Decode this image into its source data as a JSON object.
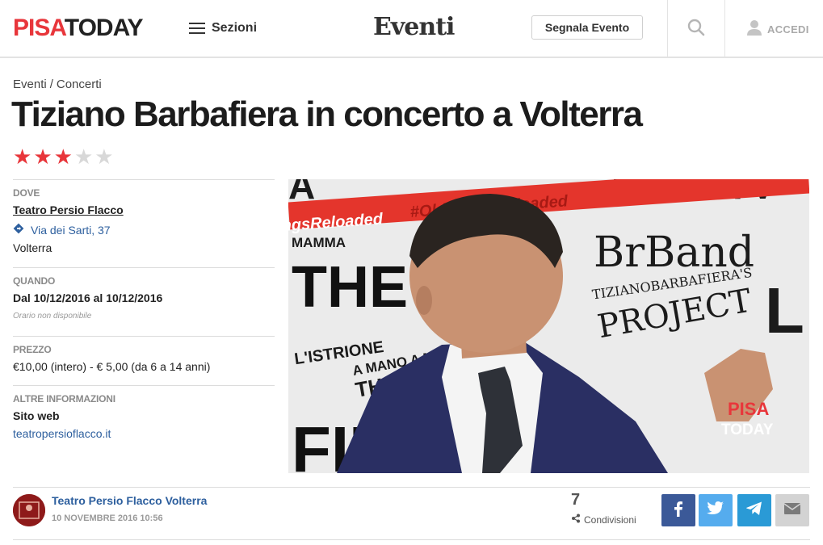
{
  "header": {
    "logo_part1": "PISA",
    "logo_part2": "TODAY",
    "menu_label": "Sezioni",
    "section_title": "Eventi",
    "report_button": "Segnala Evento",
    "login_label": "ACCEDI",
    "icons": [
      "hamburger-icon",
      "search-icon",
      "user-icon"
    ]
  },
  "breadcrumb": {
    "section": "Eventi",
    "separator": "/",
    "category": "Concerti"
  },
  "title": "Tiziano Barbafiera in concerto a Volterra",
  "rating": {
    "value": 3,
    "max": 5,
    "active_color": "#e8363b",
    "inactive_color": "#d8d8d8"
  },
  "info": {
    "where": {
      "label": "DOVE",
      "venue": "Teatro Persio Flacco",
      "address": "Via dei Sarti, 37",
      "city": "Volterra"
    },
    "when": {
      "label": "QUANDO",
      "dates": "Dal 10/12/2016 al 10/12/2016",
      "time_note": "Orario non disponibile"
    },
    "price": {
      "label": "PREZZO",
      "value": "€10,00 (intero) - € 5,00 (da 6 a 14 anni)"
    },
    "more": {
      "label": "ALTRE INFORMAZIONI",
      "website_label": "Sito web",
      "website": "teatropersioflacco.it"
    }
  },
  "poster": {
    "hashtag": "#OldSongsReloaded",
    "band": "BrBand",
    "project_line1": "TIZIANOBARBAFIERA'S",
    "project_line2": "PROJECT",
    "words": [
      "MAMMA",
      "THE",
      "L'ISTRIONE",
      "A MANO A M",
      "THE HOU",
      "FIR"
    ],
    "watermark1": "PISA",
    "watermark2": "TODAY"
  },
  "footer": {
    "author": "Teatro Persio Flacco Volterra",
    "date": "10 NOVEMBRE 2016 10:56",
    "share_count": "7",
    "share_label": "Condivisioni",
    "share_buttons": [
      {
        "name": "facebook",
        "color": "#3b5998"
      },
      {
        "name": "twitter",
        "color": "#55acee"
      },
      {
        "name": "telegram",
        "color": "#2a9ad6"
      },
      {
        "name": "email",
        "color": "#d3d3d3"
      }
    ]
  }
}
